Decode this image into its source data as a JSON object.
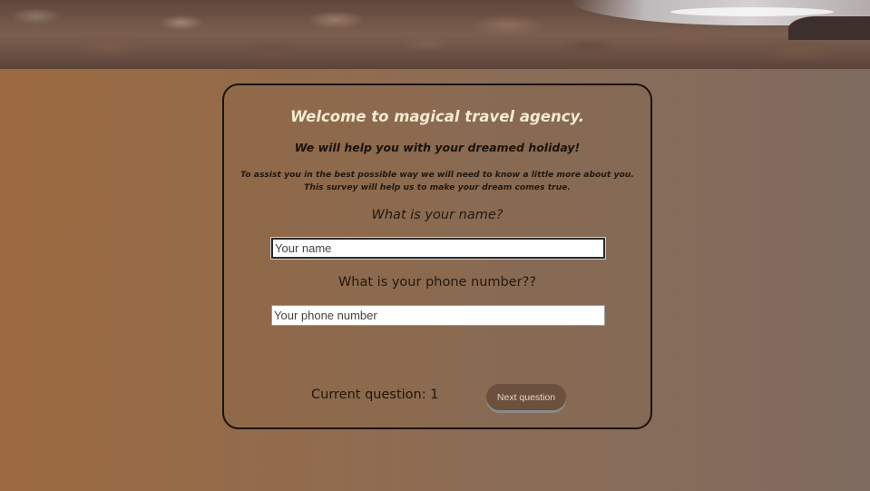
{
  "header": {
    "image": "rocky-beach-photo"
  },
  "survey": {
    "title": "Welcome to magical travel agency.",
    "subtitle": "We will help you with your dreamed holiday!",
    "intro": "To assist you in the best possible way we will need to know a little more about you. This survey will help us to make your dream comes true.",
    "questions": [
      {
        "label": "What is your name?",
        "placeholder": "Your name",
        "value": ""
      },
      {
        "label": "What is your phone number??",
        "placeholder": "Your phone number",
        "value": ""
      }
    ],
    "current_question_label": "Current question: 1",
    "next_button_label": "Next question"
  },
  "colors": {
    "title": "#f4ead2",
    "button_bg": "#6c4f3c",
    "background_left": "#9c6a40",
    "background_right": "#7f6b60"
  }
}
